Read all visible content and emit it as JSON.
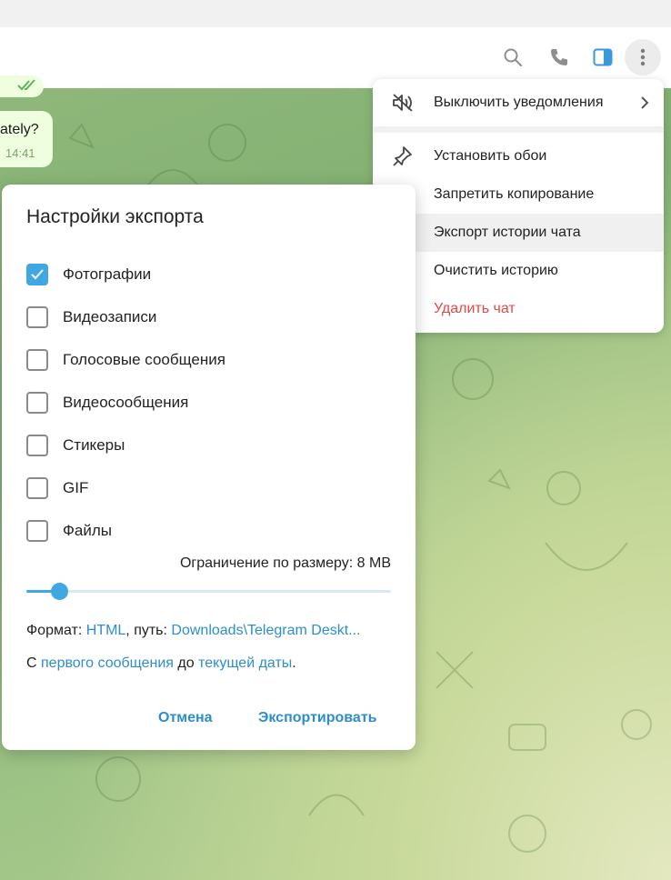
{
  "header": {
    "icons": [
      "search-icon",
      "phone-icon",
      "sidebar-toggle-icon",
      "more-vertical-icon"
    ]
  },
  "chat": {
    "bubble_text": "ately?",
    "bubble_time": "14:41"
  },
  "menu": {
    "items": [
      {
        "label": "Выключить уведомления",
        "icon": "mute-icon",
        "submenu": true
      },
      {
        "label": "Установить обои",
        "icon": "pin-icon"
      },
      {
        "label": "Запретить копирование",
        "icon": "no-forward-icon"
      },
      {
        "label": "Экспорт истории чата",
        "icon": "export-icon",
        "highlighted": true
      },
      {
        "label": "Очистить историю",
        "icon": "broom-icon"
      },
      {
        "label": "Удалить чат",
        "icon": "trash-icon",
        "danger": true
      }
    ]
  },
  "dialog": {
    "title": "Настройки экспорта",
    "options": [
      {
        "label": "Фотографии",
        "checked": true
      },
      {
        "label": "Видеозаписи",
        "checked": false
      },
      {
        "label": "Голосовые сообщения",
        "checked": false
      },
      {
        "label": "Видеосообщения",
        "checked": false
      },
      {
        "label": "Стикеры",
        "checked": false
      },
      {
        "label": "GIF",
        "checked": false
      },
      {
        "label": "Файлы",
        "checked": false
      }
    ],
    "size_limit_label": "Ограничение по размеру: 8 MB",
    "size_slider_fraction": 0.09,
    "format_prefix": "Формат: ",
    "format_value": "HTML",
    "path_prefix": ", путь: ",
    "path_value": "Downloads\\Telegram Deskt...",
    "range_prefix": "С ",
    "range_from": "первого сообщения",
    "range_mid": " до ",
    "range_to": "текущей даты",
    "range_suffix": ".",
    "cancel_label": "Отмена",
    "export_label": "Экспортировать"
  },
  "colors": {
    "accent": "#40a7e3",
    "link": "#2e8dcc",
    "danger": "#e0484a"
  }
}
